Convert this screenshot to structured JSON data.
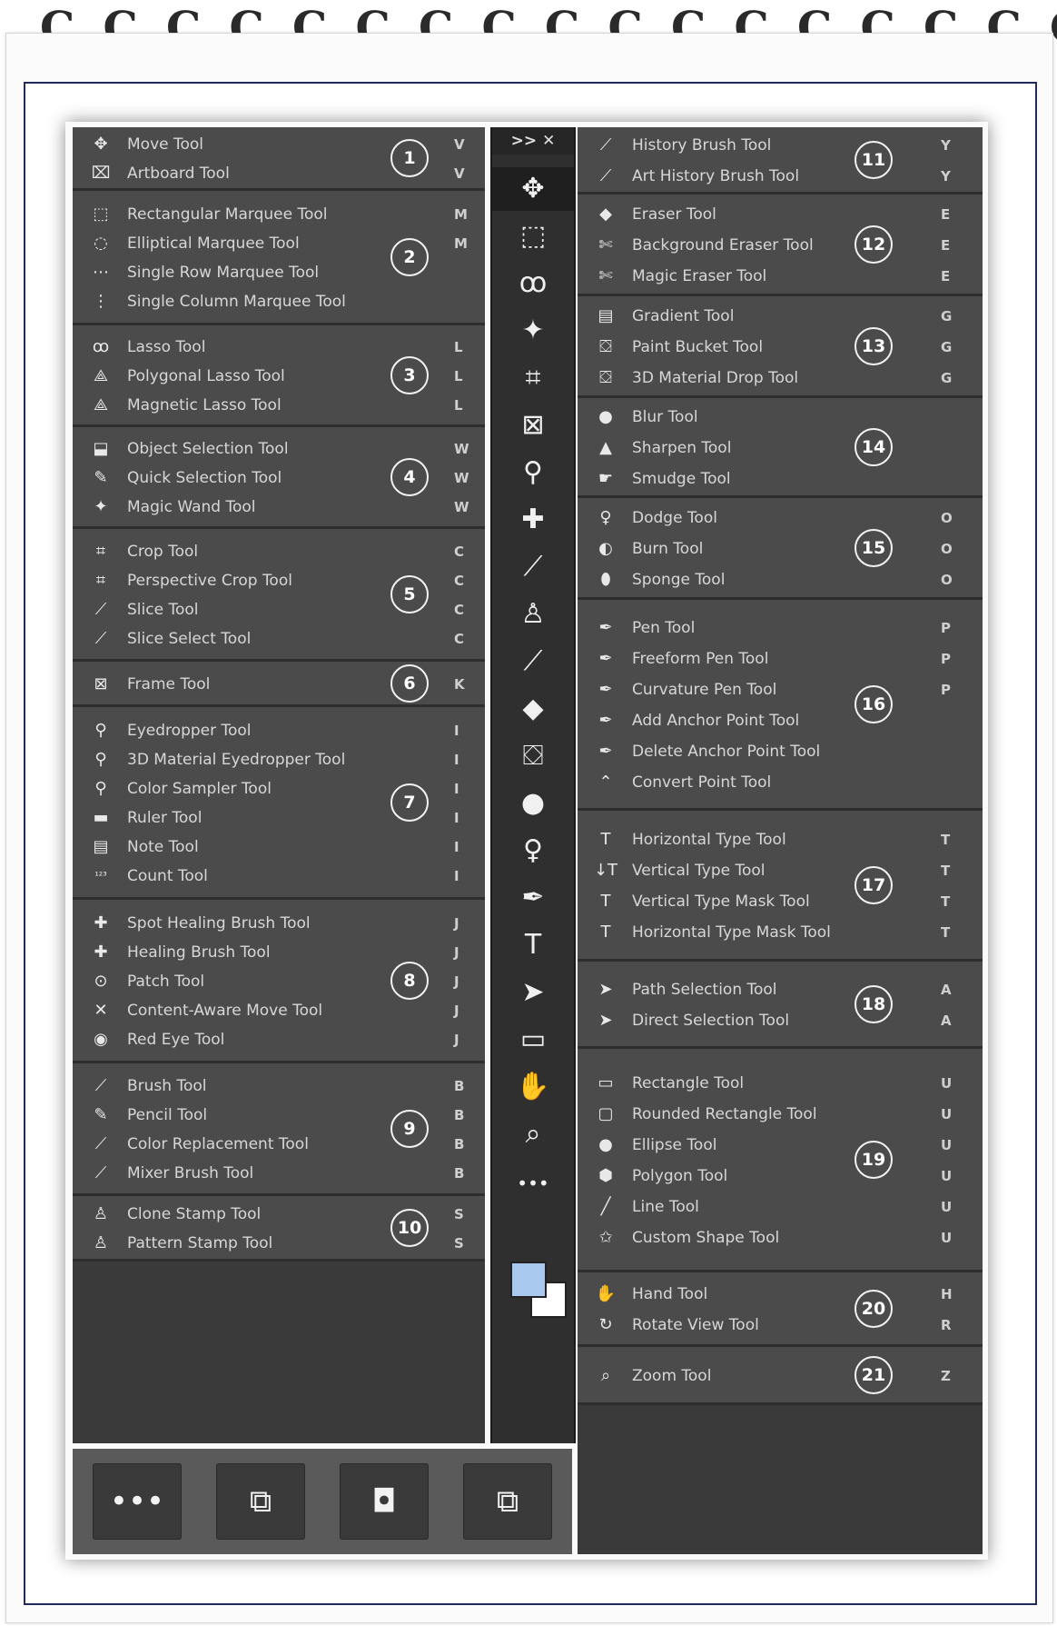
{
  "left_groups": [
    {
      "badge": "1",
      "tools": [
        {
          "label": "Move Tool",
          "key": "V",
          "icon": "move-icon"
        },
        {
          "label": "Artboard Tool",
          "key": "V",
          "icon": "artboard-icon"
        }
      ]
    },
    {
      "badge": "2",
      "tools": [
        {
          "label": "Rectangular Marquee Tool",
          "key": "M",
          "icon": "rect-marquee-icon"
        },
        {
          "label": "Elliptical Marquee Tool",
          "key": "M",
          "icon": "ellipse-marquee-icon"
        },
        {
          "label": "Single Row Marquee Tool",
          "key": "",
          "icon": "row-marquee-icon"
        },
        {
          "label": "Single Column Marquee Tool",
          "key": "",
          "icon": "column-marquee-icon"
        }
      ]
    },
    {
      "badge": "3",
      "tools": [
        {
          "label": "Lasso Tool",
          "key": "L",
          "icon": "lasso-icon"
        },
        {
          "label": "Polygonal Lasso Tool",
          "key": "L",
          "icon": "polygonal-lasso-icon"
        },
        {
          "label": "Magnetic Lasso Tool",
          "key": "L",
          "icon": "magnetic-lasso-icon"
        }
      ]
    },
    {
      "badge": "4",
      "tools": [
        {
          "label": "Object Selection Tool",
          "key": "W",
          "icon": "object-selection-icon"
        },
        {
          "label": "Quick Selection Tool",
          "key": "W",
          "icon": "quick-selection-icon"
        },
        {
          "label": "Magic Wand Tool",
          "key": "W",
          "icon": "magic-wand-icon"
        }
      ]
    },
    {
      "badge": "5",
      "tools": [
        {
          "label": "Crop Tool",
          "key": "C",
          "icon": "crop-icon"
        },
        {
          "label": "Perspective Crop Tool",
          "key": "C",
          "icon": "perspective-crop-icon"
        },
        {
          "label": "Slice Tool",
          "key": "C",
          "icon": "slice-icon"
        },
        {
          "label": "Slice Select Tool",
          "key": "C",
          "icon": "slice-select-icon"
        }
      ]
    },
    {
      "badge": "6",
      "tools": [
        {
          "label": "Frame Tool",
          "key": "K",
          "icon": "frame-icon"
        }
      ]
    },
    {
      "badge": "7",
      "tools": [
        {
          "label": "Eyedropper Tool",
          "key": "I",
          "icon": "eyedropper-icon"
        },
        {
          "label": "3D Material Eyedropper Tool",
          "key": "I",
          "icon": "3d-eyedropper-icon"
        },
        {
          "label": "Color Sampler Tool",
          "key": "I",
          "icon": "color-sampler-icon"
        },
        {
          "label": "Ruler Tool",
          "key": "I",
          "icon": "ruler-icon"
        },
        {
          "label": "Note Tool",
          "key": "I",
          "icon": "note-icon"
        },
        {
          "label": "Count Tool",
          "key": "I",
          "icon": "count-icon"
        }
      ]
    },
    {
      "badge": "8",
      "tools": [
        {
          "label": "Spot Healing Brush Tool",
          "key": "J",
          "icon": "spot-healing-icon"
        },
        {
          "label": "Healing Brush Tool",
          "key": "J",
          "icon": "healing-brush-icon"
        },
        {
          "label": "Patch Tool",
          "key": "J",
          "icon": "patch-icon"
        },
        {
          "label": "Content-Aware Move Tool",
          "key": "J",
          "icon": "content-aware-move-icon"
        },
        {
          "label": "Red Eye Tool",
          "key": "J",
          "icon": "red-eye-icon"
        }
      ]
    },
    {
      "badge": "9",
      "tools": [
        {
          "label": "Brush Tool",
          "key": "B",
          "icon": "brush-icon"
        },
        {
          "label": "Pencil Tool",
          "key": "B",
          "icon": "pencil-icon"
        },
        {
          "label": "Color Replacement Tool",
          "key": "B",
          "icon": "color-replacement-icon"
        },
        {
          "label": "Mixer Brush Tool",
          "key": "B",
          "icon": "mixer-brush-icon"
        }
      ]
    },
    {
      "badge": "10",
      "tools": [
        {
          "label": "Clone Stamp Tool",
          "key": "S",
          "icon": "clone-stamp-icon"
        },
        {
          "label": "Pattern Stamp Tool",
          "key": "S",
          "icon": "pattern-stamp-icon"
        }
      ]
    }
  ],
  "right_groups": [
    {
      "badge": "11",
      "tools": [
        {
          "label": "History Brush Tool",
          "key": "Y",
          "icon": "history-brush-icon"
        },
        {
          "label": "Art History Brush Tool",
          "key": "Y",
          "icon": "art-history-brush-icon"
        }
      ]
    },
    {
      "badge": "12",
      "tools": [
        {
          "label": "Eraser Tool",
          "key": "E",
          "icon": "eraser-icon"
        },
        {
          "label": "Background Eraser Tool",
          "key": "E",
          "icon": "background-eraser-icon"
        },
        {
          "label": "Magic Eraser Tool",
          "key": "E",
          "icon": "magic-eraser-icon"
        }
      ]
    },
    {
      "badge": "13",
      "tools": [
        {
          "label": "Gradient Tool",
          "key": "G",
          "icon": "gradient-icon"
        },
        {
          "label": "Paint Bucket Tool",
          "key": "G",
          "icon": "paint-bucket-icon"
        },
        {
          "label": "3D Material Drop Tool",
          "key": "G",
          "icon": "3d-material-drop-icon"
        }
      ]
    },
    {
      "badge": "14",
      "tools": [
        {
          "label": "Blur Tool",
          "key": "",
          "icon": "blur-icon"
        },
        {
          "label": "Sharpen Tool",
          "key": "",
          "icon": "sharpen-icon"
        },
        {
          "label": "Smudge Tool",
          "key": "",
          "icon": "smudge-icon"
        }
      ]
    },
    {
      "badge": "15",
      "tools": [
        {
          "label": "Dodge Tool",
          "key": "O",
          "icon": "dodge-icon"
        },
        {
          "label": "Burn Tool",
          "key": "O",
          "icon": "burn-icon"
        },
        {
          "label": "Sponge Tool",
          "key": "O",
          "icon": "sponge-icon"
        }
      ]
    },
    {
      "badge": "16",
      "tools": [
        {
          "label": "Pen Tool",
          "key": "P",
          "icon": "pen-icon"
        },
        {
          "label": "Freeform Pen Tool",
          "key": "P",
          "icon": "freeform-pen-icon"
        },
        {
          "label": "Curvature Pen Tool",
          "key": "P",
          "icon": "curvature-pen-icon"
        },
        {
          "label": "Add Anchor Point Tool",
          "key": "",
          "icon": "add-anchor-icon"
        },
        {
          "label": "Delete Anchor Point Tool",
          "key": "",
          "icon": "delete-anchor-icon"
        },
        {
          "label": "Convert Point Tool",
          "key": "",
          "icon": "convert-point-icon"
        }
      ]
    },
    {
      "badge": "17",
      "tools": [
        {
          "label": "Horizontal Type Tool",
          "key": "T",
          "icon": "horizontal-type-icon"
        },
        {
          "label": "Vertical Type Tool",
          "key": "T",
          "icon": "vertical-type-icon"
        },
        {
          "label": "Vertical Type Mask Tool",
          "key": "T",
          "icon": "vertical-type-mask-icon"
        },
        {
          "label": "Horizontal Type Mask Tool",
          "key": "T",
          "icon": "horizontal-type-mask-icon"
        }
      ]
    },
    {
      "badge": "18",
      "tools": [
        {
          "label": "Path Selection Tool",
          "key": "A",
          "icon": "path-selection-icon"
        },
        {
          "label": "Direct Selection Tool",
          "key": "A",
          "icon": "direct-selection-icon"
        }
      ]
    },
    {
      "badge": "19",
      "tools": [
        {
          "label": "Rectangle Tool",
          "key": "U",
          "icon": "rectangle-icon"
        },
        {
          "label": "Rounded Rectangle Tool",
          "key": "U",
          "icon": "rounded-rectangle-icon"
        },
        {
          "label": "Ellipse Tool",
          "key": "U",
          "icon": "ellipse-icon"
        },
        {
          "label": "Polygon Tool",
          "key": "U",
          "icon": "polygon-icon"
        },
        {
          "label": "Line Tool",
          "key": "U",
          "icon": "line-icon"
        },
        {
          "label": "Custom Shape Tool",
          "key": "U",
          "icon": "custom-shape-icon"
        }
      ]
    },
    {
      "badge": "20",
      "tools": [
        {
          "label": "Hand Tool",
          "key": "H",
          "icon": "hand-icon"
        },
        {
          "label": "Rotate View Tool",
          "key": "R",
          "icon": "rotate-view-icon"
        }
      ]
    },
    {
      "badge": "21",
      "tools": [
        {
          "label": "Zoom Tool",
          "key": "Z",
          "icon": "zoom-icon"
        }
      ]
    }
  ],
  "toolbar": {
    "header": ">>  ✕",
    "icons": [
      "move-icon",
      "rect-marquee-icon",
      "lasso-icon",
      "magic-wand-icon",
      "crop-icon",
      "frame-icon",
      "eyedropper-icon",
      "spot-healing-icon",
      "brush-icon",
      "clone-stamp-icon",
      "history-brush-icon",
      "eraser-icon",
      "paint-bucket-icon",
      "blur-icon",
      "dodge-icon",
      "pen-icon",
      "horizontal-type-icon",
      "path-selection-icon",
      "rectangle-icon",
      "hand-icon",
      "zoom-icon",
      "more-icon"
    ],
    "active_index": 0,
    "foreground_color": "#a9c9ee",
    "background_color": "#ffffff"
  },
  "bottom_bar": {
    "icons": [
      "more-icon",
      "swap-colors-icon",
      "quick-mask-icon",
      "screen-mode-icon"
    ]
  }
}
